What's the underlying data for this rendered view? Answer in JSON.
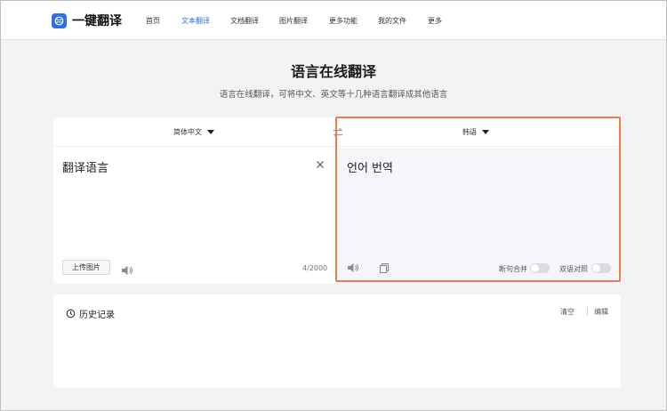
{
  "header": {
    "brand": "一键翻译",
    "nav": [
      {
        "label": "首页",
        "active": false
      },
      {
        "label": "文本翻译",
        "active": true
      },
      {
        "label": "文档翻译",
        "active": false
      },
      {
        "label": "图片翻译",
        "active": false
      },
      {
        "label": "更多功能",
        "active": false
      },
      {
        "label": "我的文件",
        "active": false
      },
      {
        "label": "更多",
        "active": false
      }
    ]
  },
  "hero": {
    "title": "语言在线翻译",
    "subtitle": "语言在线翻译，可将中文、英文等十几种语言翻译成其他语言"
  },
  "translator": {
    "source_lang": "简体中文",
    "target_lang": "韩语",
    "source_text": "翻译语言",
    "target_text": "언어 번역",
    "upload_label": "上传图片",
    "char_count": "4/2000",
    "toggle_merge_label": "断句合并",
    "toggle_bilingual_label": "双语对照",
    "toggle_merge_on": false,
    "toggle_bilingual_on": false
  },
  "history": {
    "title": "历史记录",
    "clear_label": "清空",
    "edit_label": "编辑"
  },
  "colors": {
    "accent": "#2f6fe4",
    "highlight": "#f07a4a",
    "background": "#f2f3f5"
  }
}
